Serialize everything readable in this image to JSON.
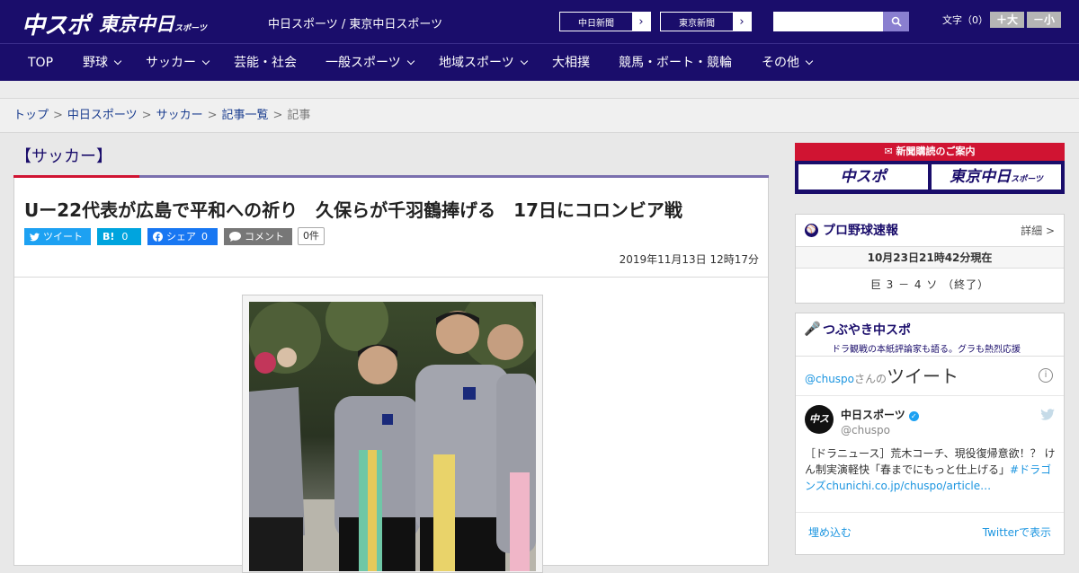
{
  "header": {
    "logo_main": "中スポ",
    "logo_sub": "東京中日",
    "logo_sub_small": "スポーツ",
    "site_title": "中日スポーツ / 東京中日スポーツ",
    "paper_buttons": [
      "中日新聞",
      "東京新聞"
    ],
    "font_size_label": "文字（0）",
    "font_larger": "＋大",
    "font_smaller": "－小"
  },
  "nav": {
    "items": [
      {
        "label": "TOP"
      },
      {
        "label": "野球"
      },
      {
        "label": "サッカー"
      },
      {
        "label": "芸能・社会"
      },
      {
        "label": "一般スポーツ"
      },
      {
        "label": "地域スポーツ"
      },
      {
        "label": "大相撲"
      },
      {
        "label": "競馬・ボート・競輪"
      },
      {
        "label": "その他"
      }
    ]
  },
  "breadcrumb": {
    "items": [
      "トップ",
      "中日スポーツ",
      "サッカー",
      "記事一覧"
    ],
    "current": "記事",
    "separator": ">"
  },
  "article": {
    "category": "【サッカー】",
    "headline": "Uー22代表が広島で平和への祈り　久保らが千羽鶴捧げる　17日にコロンビア戦",
    "share": {
      "tweet": "ツイート",
      "hatena_label": "B!",
      "hatena_count": "0",
      "facebook": "シェア",
      "facebook_count": "0",
      "comment": "コメント",
      "comment_count": "0件"
    },
    "date": "2019年11月13日 12時17分"
  },
  "sidebar": {
    "ad_banner": "新聞購読のご案内",
    "ad_logo_1": "中スポ",
    "ad_logo_2": "東京中日",
    "ad_logo_2_small": "スポーツ",
    "baseball": {
      "title": "プロ野球速報",
      "detail": "詳細 >",
      "time": "10月23日21時42分現在",
      "score": "巨 3 － 4 ソ （終了）"
    },
    "tsubuyaki": {
      "title": "つぶやき中スポ",
      "subtitle": "ドラ観戦の本紙評論家も語る。グラも熱烈応援",
      "embed_handle_prefix": "@chuspo",
      "embed_handle_suffix": "さんの",
      "embed_title": "ツイート",
      "tweet_name": "中日スポーツ",
      "tweet_handle": "@chuspo",
      "tweet_text": "［ドラニュース］荒木コーチ、現役復帰意欲！？ けん制実演軽快「春までにもっと仕上げる」",
      "tweet_link": "#ドラゴンズchunichi.co.jp/chuspo/article…",
      "embed_link": "埋め込む",
      "view_link": "Twitterで表示"
    }
  },
  "colors": {
    "brand_navy": "#1a0d6b",
    "accent_red": "#d01432",
    "twitter_blue": "#1da1f2",
    "hatena_blue": "#00a4de",
    "facebook_blue": "#1877f2",
    "comment_gray": "#777777"
  }
}
